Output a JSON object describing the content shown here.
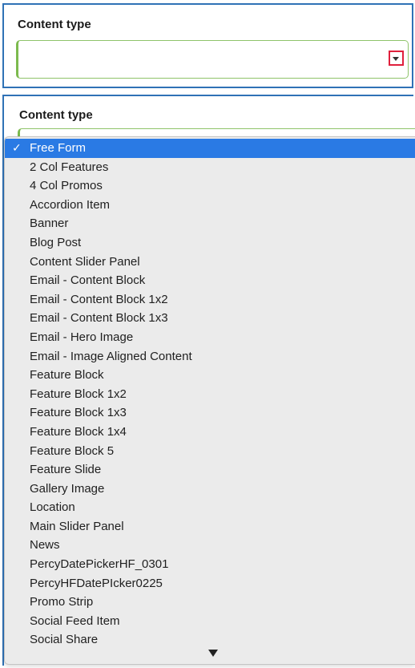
{
  "top_field": {
    "label": "Content type",
    "value": ""
  },
  "bottom_field": {
    "label": "Content type"
  },
  "dropdown": {
    "selected_index": 0,
    "check_glyph": "✓",
    "options": [
      "Free Form",
      "2 Col Features",
      "4 Col Promos",
      "Accordion Item",
      "Banner",
      "Blog Post",
      "Content Slider Panel",
      "Email - Content Block",
      "Email - Content Block 1x2",
      "Email - Content Block 1x3",
      "Email - Hero Image",
      "Email - Image Aligned Content",
      "Feature Block",
      "Feature Block 1x2",
      "Feature Block 1x3",
      "Feature Block 1x4",
      "Feature Block 5",
      "Feature Slide",
      "Gallery Image",
      "Location",
      "Main Slider Panel",
      "News",
      "PercyDatePickerHF_0301",
      "PercyHFDatePIcker0225",
      "Promo Strip",
      "Social Feed Item",
      "Social Share"
    ]
  },
  "colors": {
    "panel_border": "#2f72b6",
    "field_border": "#7cba4e",
    "toggle_highlight": "#e0203c",
    "selected_bg": "#2a7ae4",
    "menu_bg": "#ebebeb"
  },
  "icons": {
    "toggle": "chevron-down-icon",
    "check": "check-icon",
    "scroll": "scroll-down-arrow-icon"
  }
}
